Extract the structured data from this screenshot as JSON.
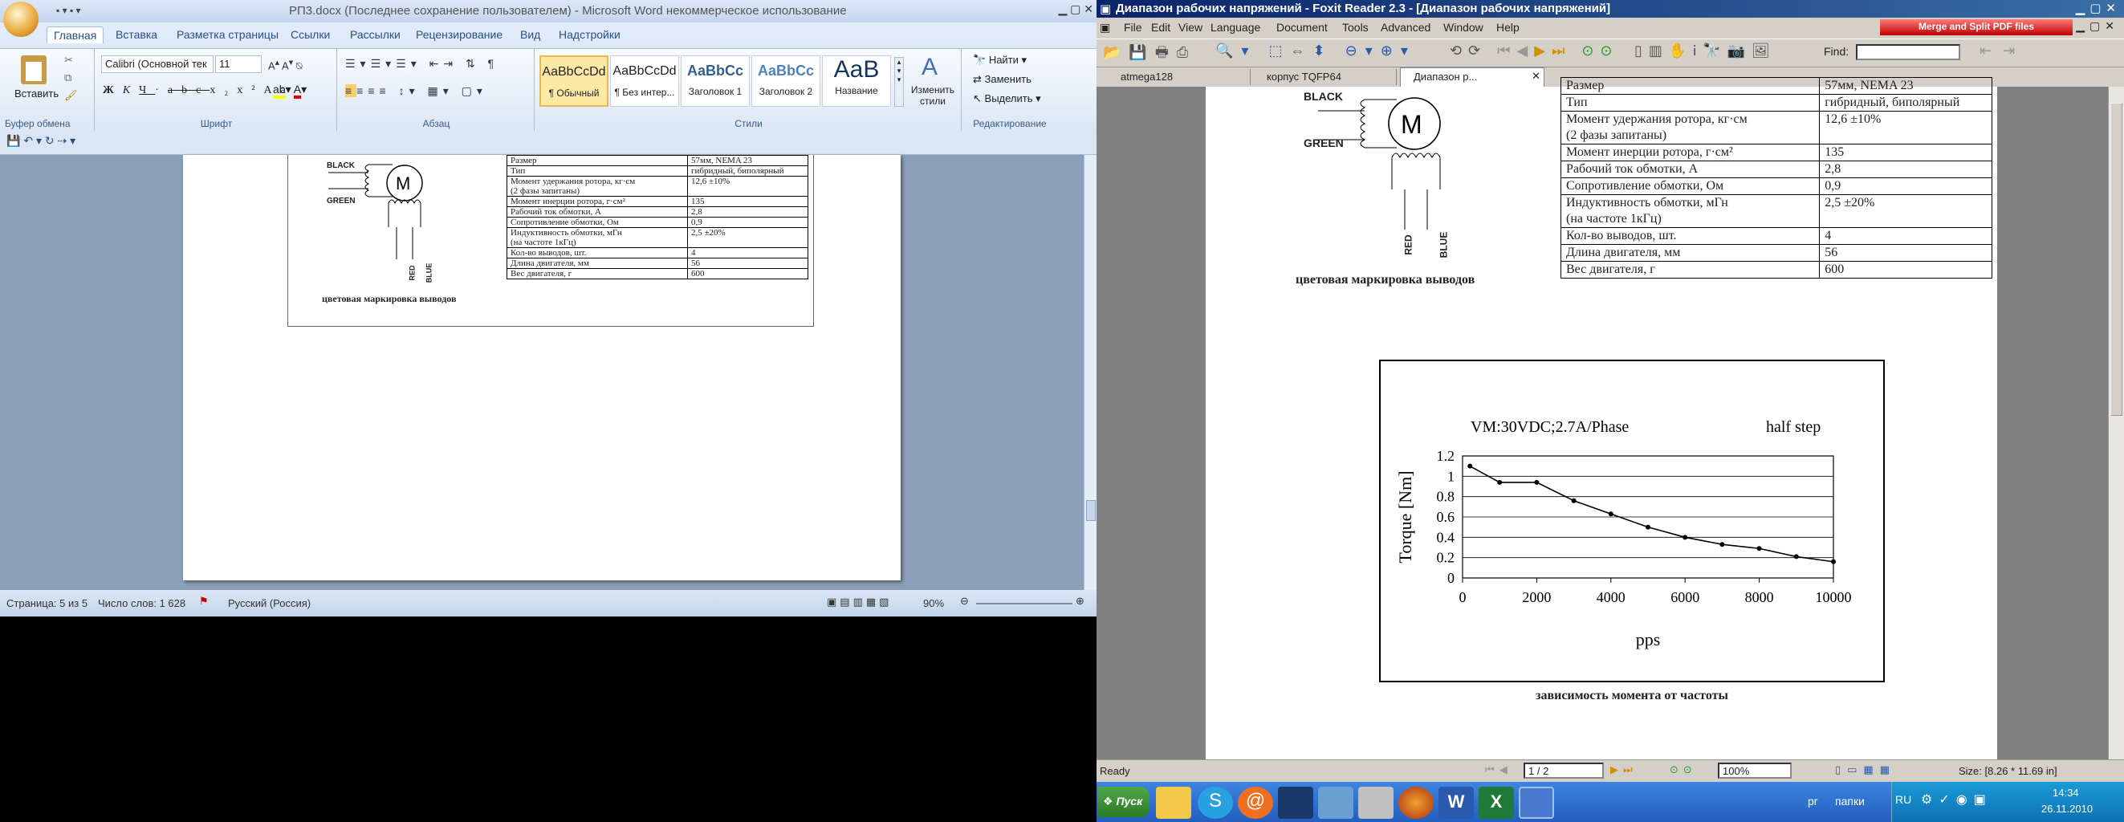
{
  "word": {
    "title": "РП3.docx (Последнее сохранение пользователем)  -  Microsoft Word некоммерческое использование",
    "tabs": [
      "Главная",
      "Вставка",
      "Разметка страницы",
      "Ссылки",
      "Рассылки",
      "Рецензирование",
      "Вид",
      "Надстройки"
    ],
    "groups": {
      "clipboard": "Буфер обмена",
      "font": "Шрифт",
      "paragraph": "Абзац",
      "styles": "Стили",
      "editing": "Редактирование"
    },
    "paste_label": "Вставить",
    "font_name": "Calibri (Основной тек",
    "font_size": "11",
    "styles": [
      {
        "sample": "AaBbCcDd",
        "name": "¶ Обычный"
      },
      {
        "sample": "AaBbCcDd",
        "name": "¶ Без интер..."
      },
      {
        "sample": "AaBbCc",
        "name": "Заголовок 1"
      },
      {
        "sample": "AaBbCc",
        "name": "Заголовок 2"
      },
      {
        "sample": "AaB",
        "name": "Название"
      }
    ],
    "change_styles": "Изменить стили",
    "editing": {
      "find": "Найти",
      "replace": "Заменить",
      "select": "Выделить"
    },
    "status": {
      "page": "Страница: 5 из 5",
      "words": "Число слов: 1 628",
      "lang": "Русский (Россия)",
      "zoom": "90%"
    }
  },
  "doc": {
    "wire_labels": {
      "black": "BLACK",
      "green": "GREEN",
      "red": "RED",
      "blue": "BLUE"
    },
    "caption": "цветовая маркировка выводов",
    "rows": [
      [
        "Размер",
        "57мм, NEMA 23"
      ],
      [
        "Тип",
        "гибридный, биполярный"
      ],
      [
        "Момент удержания ротора, кг·см\n(2 фазы запитаны)",
        "12,6 ±10%"
      ],
      [
        "Момент инерции ротора, г·см²",
        "135"
      ],
      [
        "Рабочий ток обмотки, А",
        "2,8"
      ],
      [
        "Сопротивление обмотки, Ом",
        "0,9"
      ],
      [
        "Индуктивность обмотки, мГн\n(на частоте 1кГц)",
        "2,5 ±20%"
      ],
      [
        "Кол-во выводов, шт.",
        "4"
      ],
      [
        "Длина двигателя, мм",
        "56"
      ],
      [
        "Вес двигателя, г",
        "600"
      ]
    ]
  },
  "foxit": {
    "title": "Диапазон рабочих напряжений - Foxit Reader 2.3 - [Диапазон рабочих напряжений]",
    "menu": [
      "File",
      "Edit",
      "View",
      "Language",
      "Document",
      "Tools",
      "Advanced",
      "Window",
      "Help"
    ],
    "ad": "Merge and Split PDF files",
    "find_label": "Find:",
    "tabs": [
      "atmega128",
      "корпус TQFP64",
      "Диапазон р..."
    ],
    "status": {
      "ready": "Ready",
      "page": "1 / 2",
      "zoom": "100%",
      "size": "Size: [8.26 * 11.69 in]"
    },
    "chart_caption": "зависимость момента от частоты"
  },
  "chart_data": {
    "type": "line",
    "annotations": [
      "VM:30VDC;2.7A/Phase",
      "half step"
    ],
    "xlabel": "pps",
    "ylabel": "Torque [Nm]",
    "xlim": [
      0,
      10000
    ],
    "ylim": [
      0,
      1.2
    ],
    "xticks": [
      "0",
      "2000",
      "4000",
      "6000",
      "8000",
      "10000"
    ],
    "yticks": [
      "0",
      "0.2",
      "0.4",
      "0.6",
      "0.8",
      "1",
      "1.2"
    ],
    "grid": true,
    "x": [
      200,
      1000,
      2000,
      3000,
      4000,
      5000,
      6000,
      7000,
      8000,
      9000,
      10000
    ],
    "y": [
      1.1,
      0.94,
      0.94,
      0.76,
      0.63,
      0.5,
      0.4,
      0.33,
      0.29,
      0.21,
      0.16
    ]
  },
  "taskbar": {
    "start": "Пуск",
    "tray": [
      "pr",
      "папки",
      "RU"
    ],
    "time": "14:34",
    "date": "26.11.2010"
  }
}
